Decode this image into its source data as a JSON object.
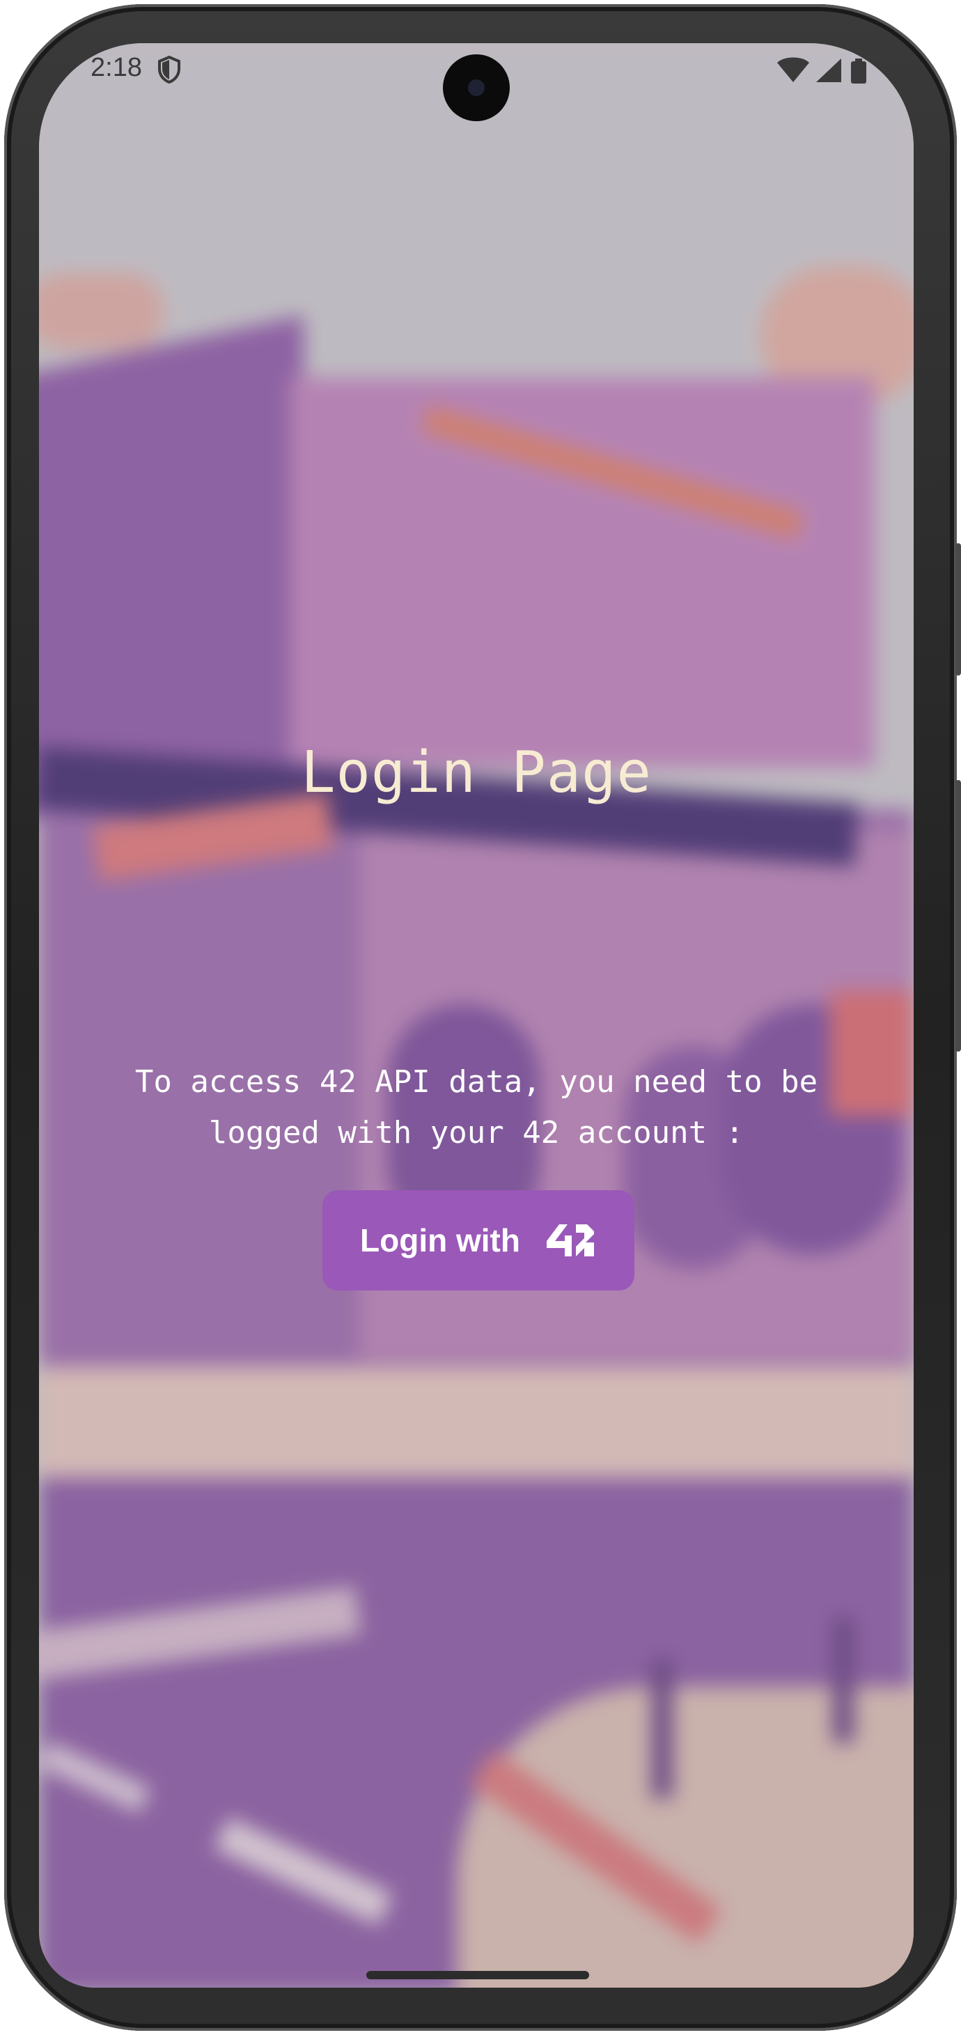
{
  "status_bar": {
    "time": "2:18",
    "icons": [
      "shield-icon",
      "wifi-icon",
      "signal-icon",
      "battery-icon"
    ]
  },
  "page": {
    "title": "Login Page",
    "info_text": "To access 42 API data, you need to be logged with your 42 account :",
    "login_button": {
      "label": "Login with",
      "logo": "42",
      "color": "#9a58b8"
    }
  },
  "colors": {
    "title_text": "#f7ecd2",
    "body_text": "#ffffff",
    "background_tint": "#b885b5"
  }
}
